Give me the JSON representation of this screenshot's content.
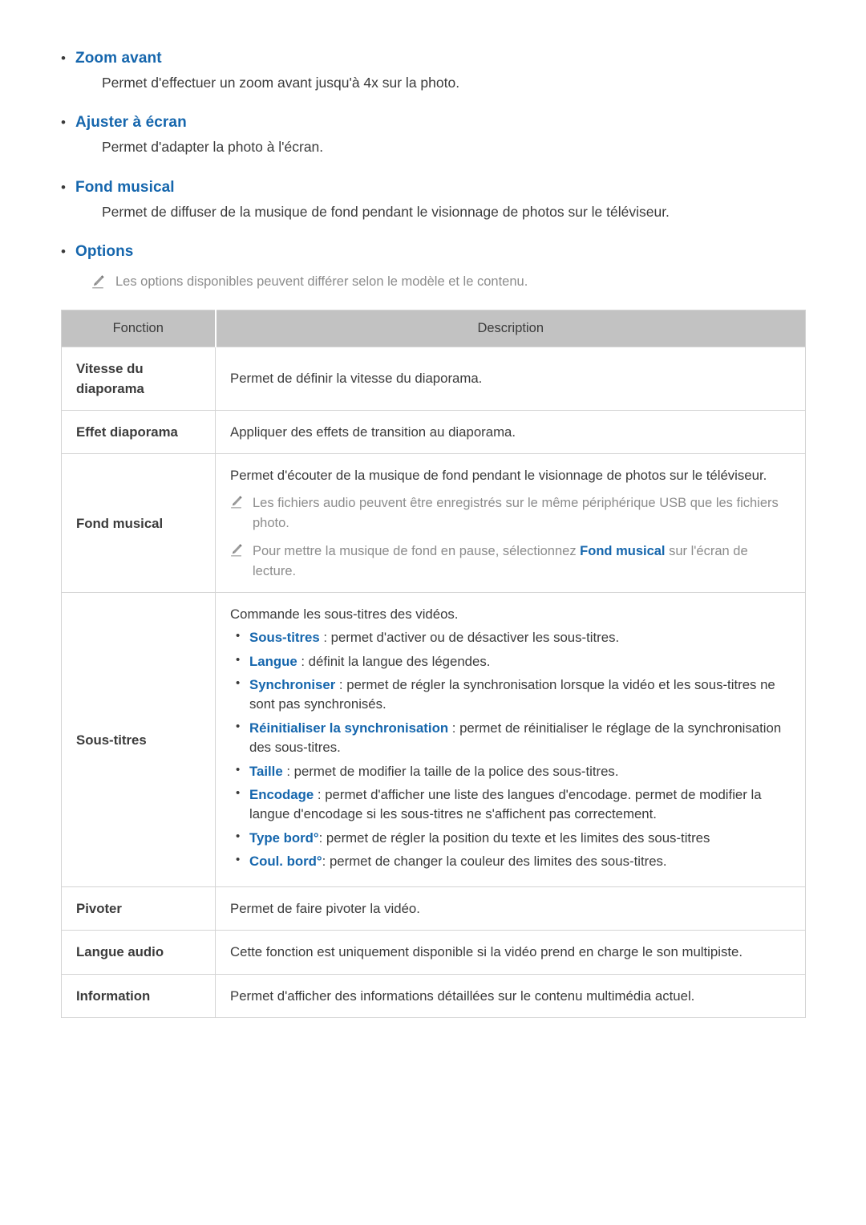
{
  "colors": {
    "link_blue": "#1566ad",
    "body_text": "#3b3b3b",
    "note_text": "#8c8c8c",
    "table_header_bg": "#c2c2c2",
    "table_border": "#d4d4d4"
  },
  "sections": [
    {
      "title": "Zoom avant",
      "body": "Permet d'effectuer un zoom avant jusqu'à 4x sur la photo."
    },
    {
      "title": "Ajuster à écran",
      "body": "Permet d'adapter la photo à l'écran."
    },
    {
      "title": "Fond musical",
      "body": "Permet de diffuser de la musique de fond pendant le visionnage de photos sur le téléviseur."
    },
    {
      "title": "Options",
      "note": "Les options disponibles peuvent différer selon le modèle et le contenu."
    }
  ],
  "table": {
    "headers": {
      "function": "Fonction",
      "description": "Description"
    },
    "rows": {
      "vitesse": {
        "function": "Vitesse du diaporama",
        "description": "Permet de définir la vitesse du diaporama."
      },
      "effet": {
        "function": "Effet diaporama",
        "description": "Appliquer des effets de transition au diaporama."
      },
      "fond_musical": {
        "function": "Fond musical",
        "lead": "Permet d'écouter de la musique de fond pendant le visionnage de photos sur le téléviseur.",
        "note1": "Les fichiers audio peuvent être enregistrés sur le même périphérique USB que les fichiers photo.",
        "note2_pre": "Pour mettre la musique de fond en pause, sélectionnez ",
        "note2_link": "Fond musical",
        "note2_post": " sur l'écran de lecture."
      },
      "sous_titres": {
        "function": "Sous-titres",
        "lead": "Commande les sous-titres des vidéos.",
        "items": [
          {
            "term": "Sous-titres",
            "sep": " : ",
            "text": "permet d'activer ou de désactiver les sous-titres."
          },
          {
            "term": "Langue",
            "sep": " : ",
            "text": "définit la langue des légendes."
          },
          {
            "term": "Synchroniser",
            "sep": " : ",
            "text": "permet de régler la synchronisation lorsque la vidéo et les sous-titres ne sont pas synchronisés."
          },
          {
            "term": "Réinitialiser la synchronisation",
            "sep": " : ",
            "text": "permet de réinitialiser le réglage de la synchronisation des sous-titres."
          },
          {
            "term": "Taille",
            "sep": " : ",
            "text": "permet de modifier la taille de la police des sous-titres."
          },
          {
            "term": "Encodage",
            "sep": " : ",
            "text": "permet d'afficher une liste des langues d'encodage. permet de modifier la langue d'encodage si les sous-titres ne s'affichent pas correctement."
          },
          {
            "term": "Type bord°",
            "sep": ": ",
            "text": "permet de régler la position du texte et les limites des sous-titres"
          },
          {
            "term": "Coul. bord°",
            "sep": ": ",
            "text": "permet de changer la couleur des limites des sous-titres."
          }
        ]
      },
      "pivoter": {
        "function": "Pivoter",
        "description": "Permet de faire pivoter la vidéo."
      },
      "langue_audio": {
        "function": "Langue audio",
        "description": "Cette fonction est uniquement disponible si la vidéo prend en charge le son multipiste."
      },
      "information": {
        "function": "Information",
        "description": "Permet d'afficher des informations détaillées sur le contenu multimédia actuel."
      }
    }
  }
}
